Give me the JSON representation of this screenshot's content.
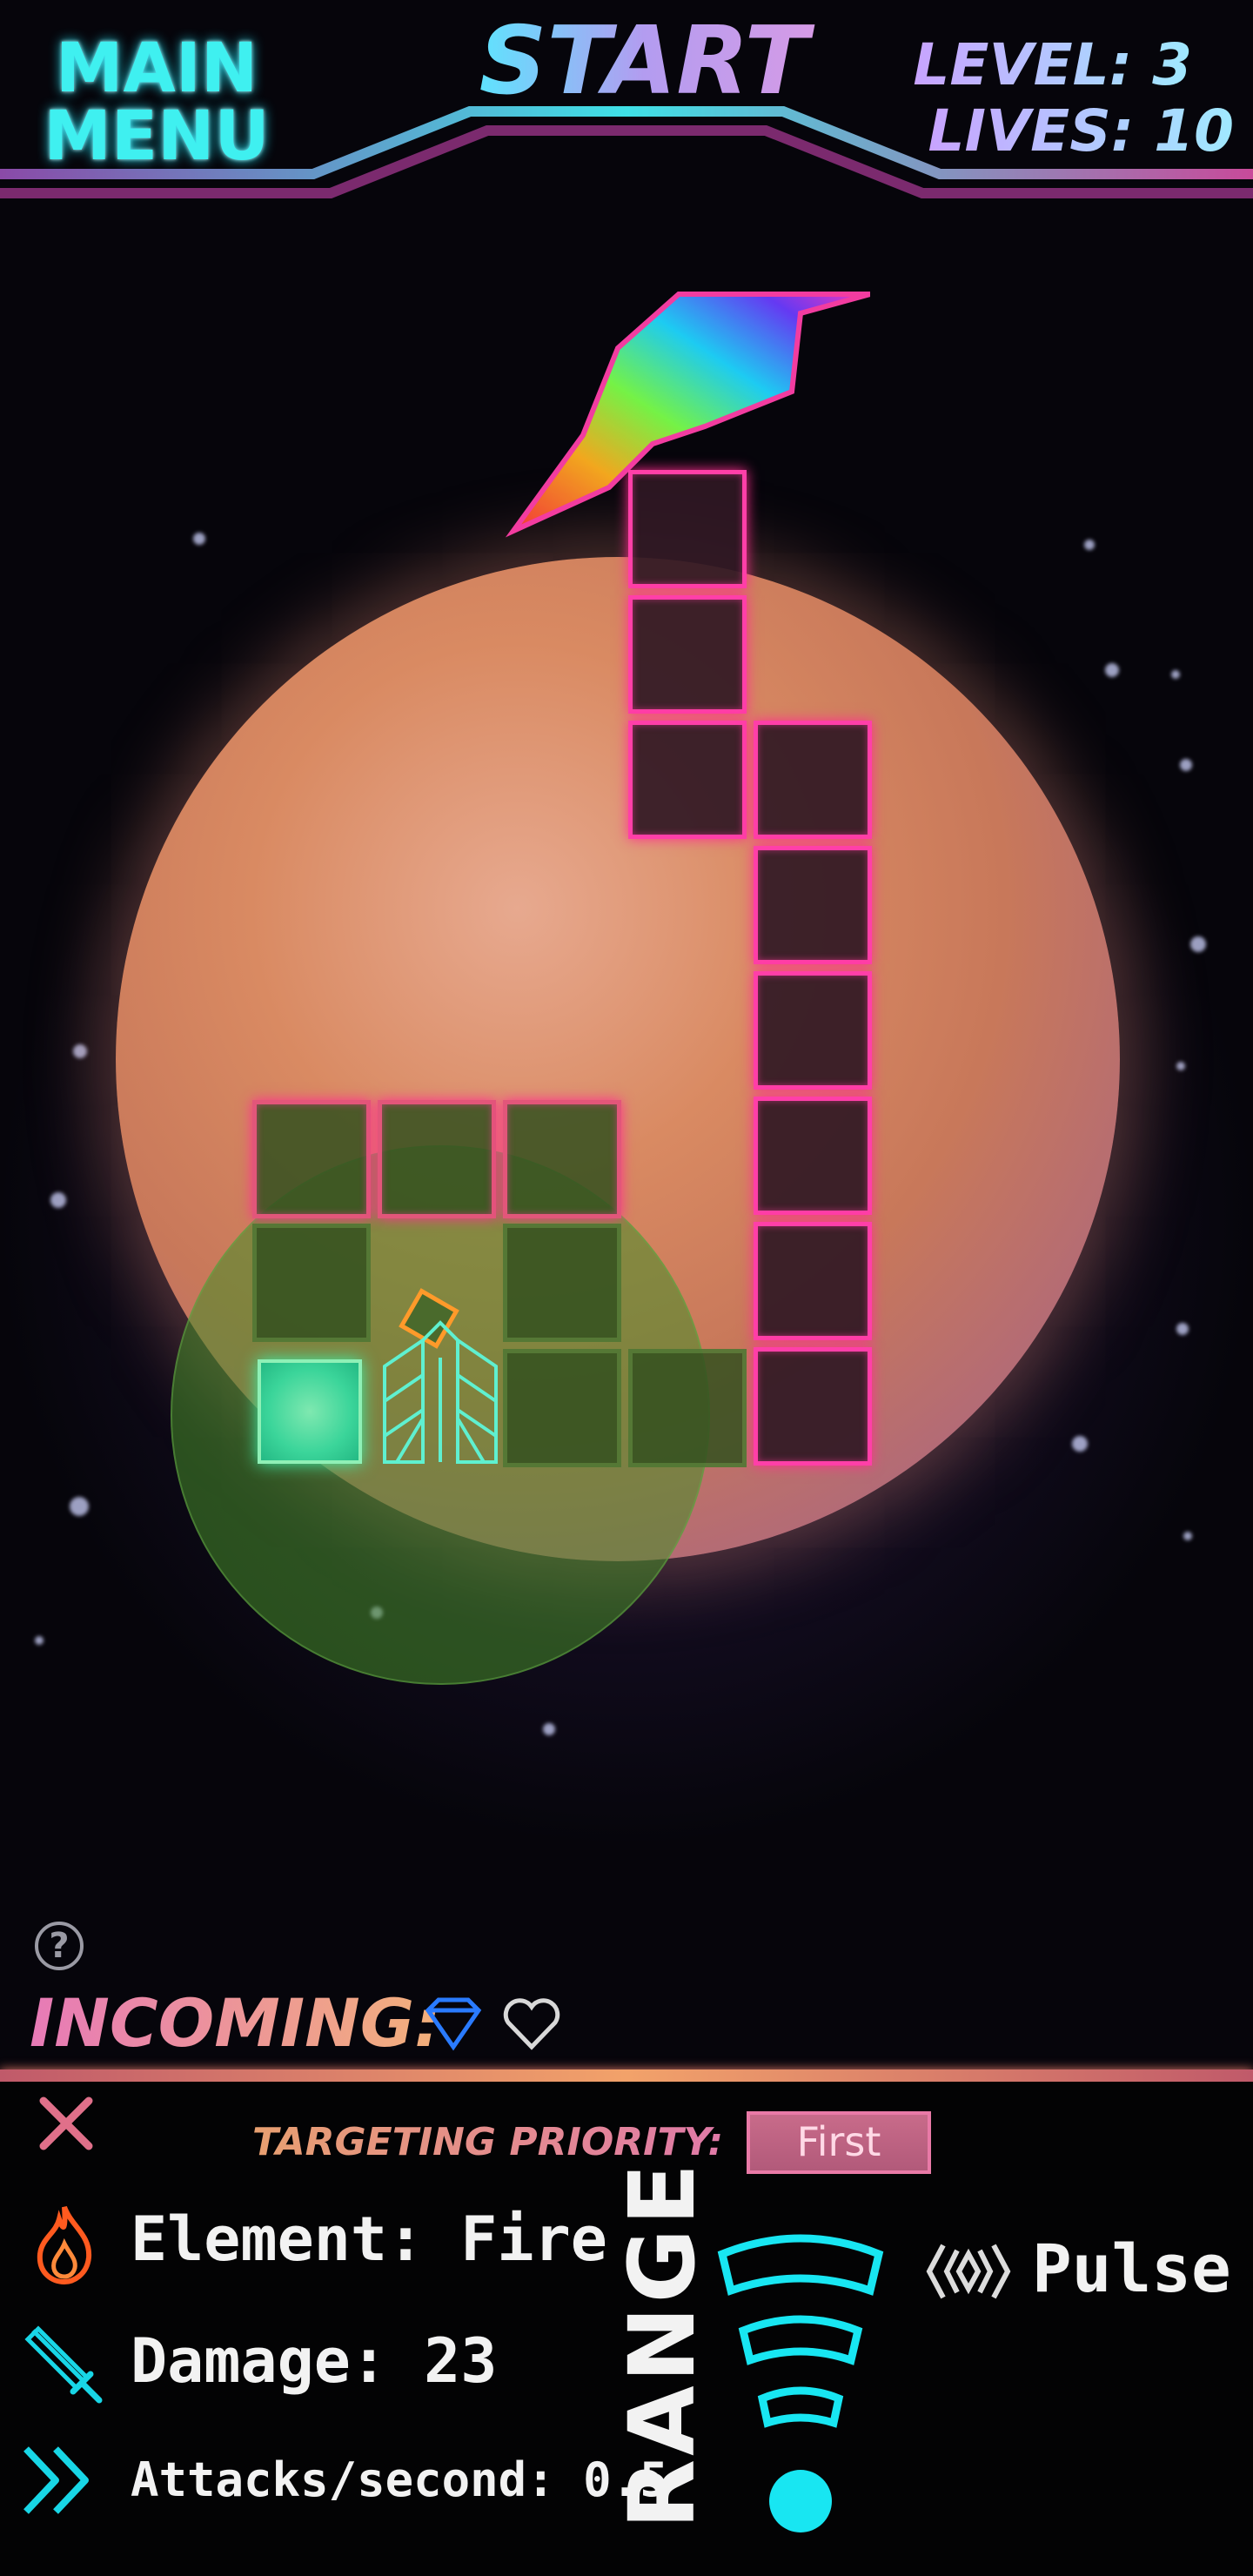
{
  "header": {
    "main_menu_line1": "MAIN",
    "main_menu_line2": "MENU",
    "start_label": "START",
    "level_text": "LEVEL: 3",
    "lives_text": "LIVES: 10"
  },
  "game": {
    "level": 3,
    "lives": 10
  },
  "incoming": {
    "label": "INCOMING:",
    "icons": [
      "diamond-icon",
      "heart-icon"
    ]
  },
  "help_glyph": "?",
  "tower_panel": {
    "targeting_label": "TARGETING PRIORITY:",
    "targeting_value": "First",
    "element": "Element: Fire",
    "damage": "Damage: 23",
    "attacks": "Attacks/second: 0.5",
    "range_label": "RANGE",
    "special_label": "Pulse"
  },
  "colors": {
    "neon_pink": "#ff3fa8",
    "neon_cyan": "#18e6f2",
    "neon_green": "#3df0a8",
    "fire_orange": "#ff5a1f"
  },
  "icons": [
    "close-icon",
    "fire-icon",
    "sword-icon",
    "chevrons-icon",
    "range-icon",
    "pulse-icon",
    "help-icon"
  ]
}
